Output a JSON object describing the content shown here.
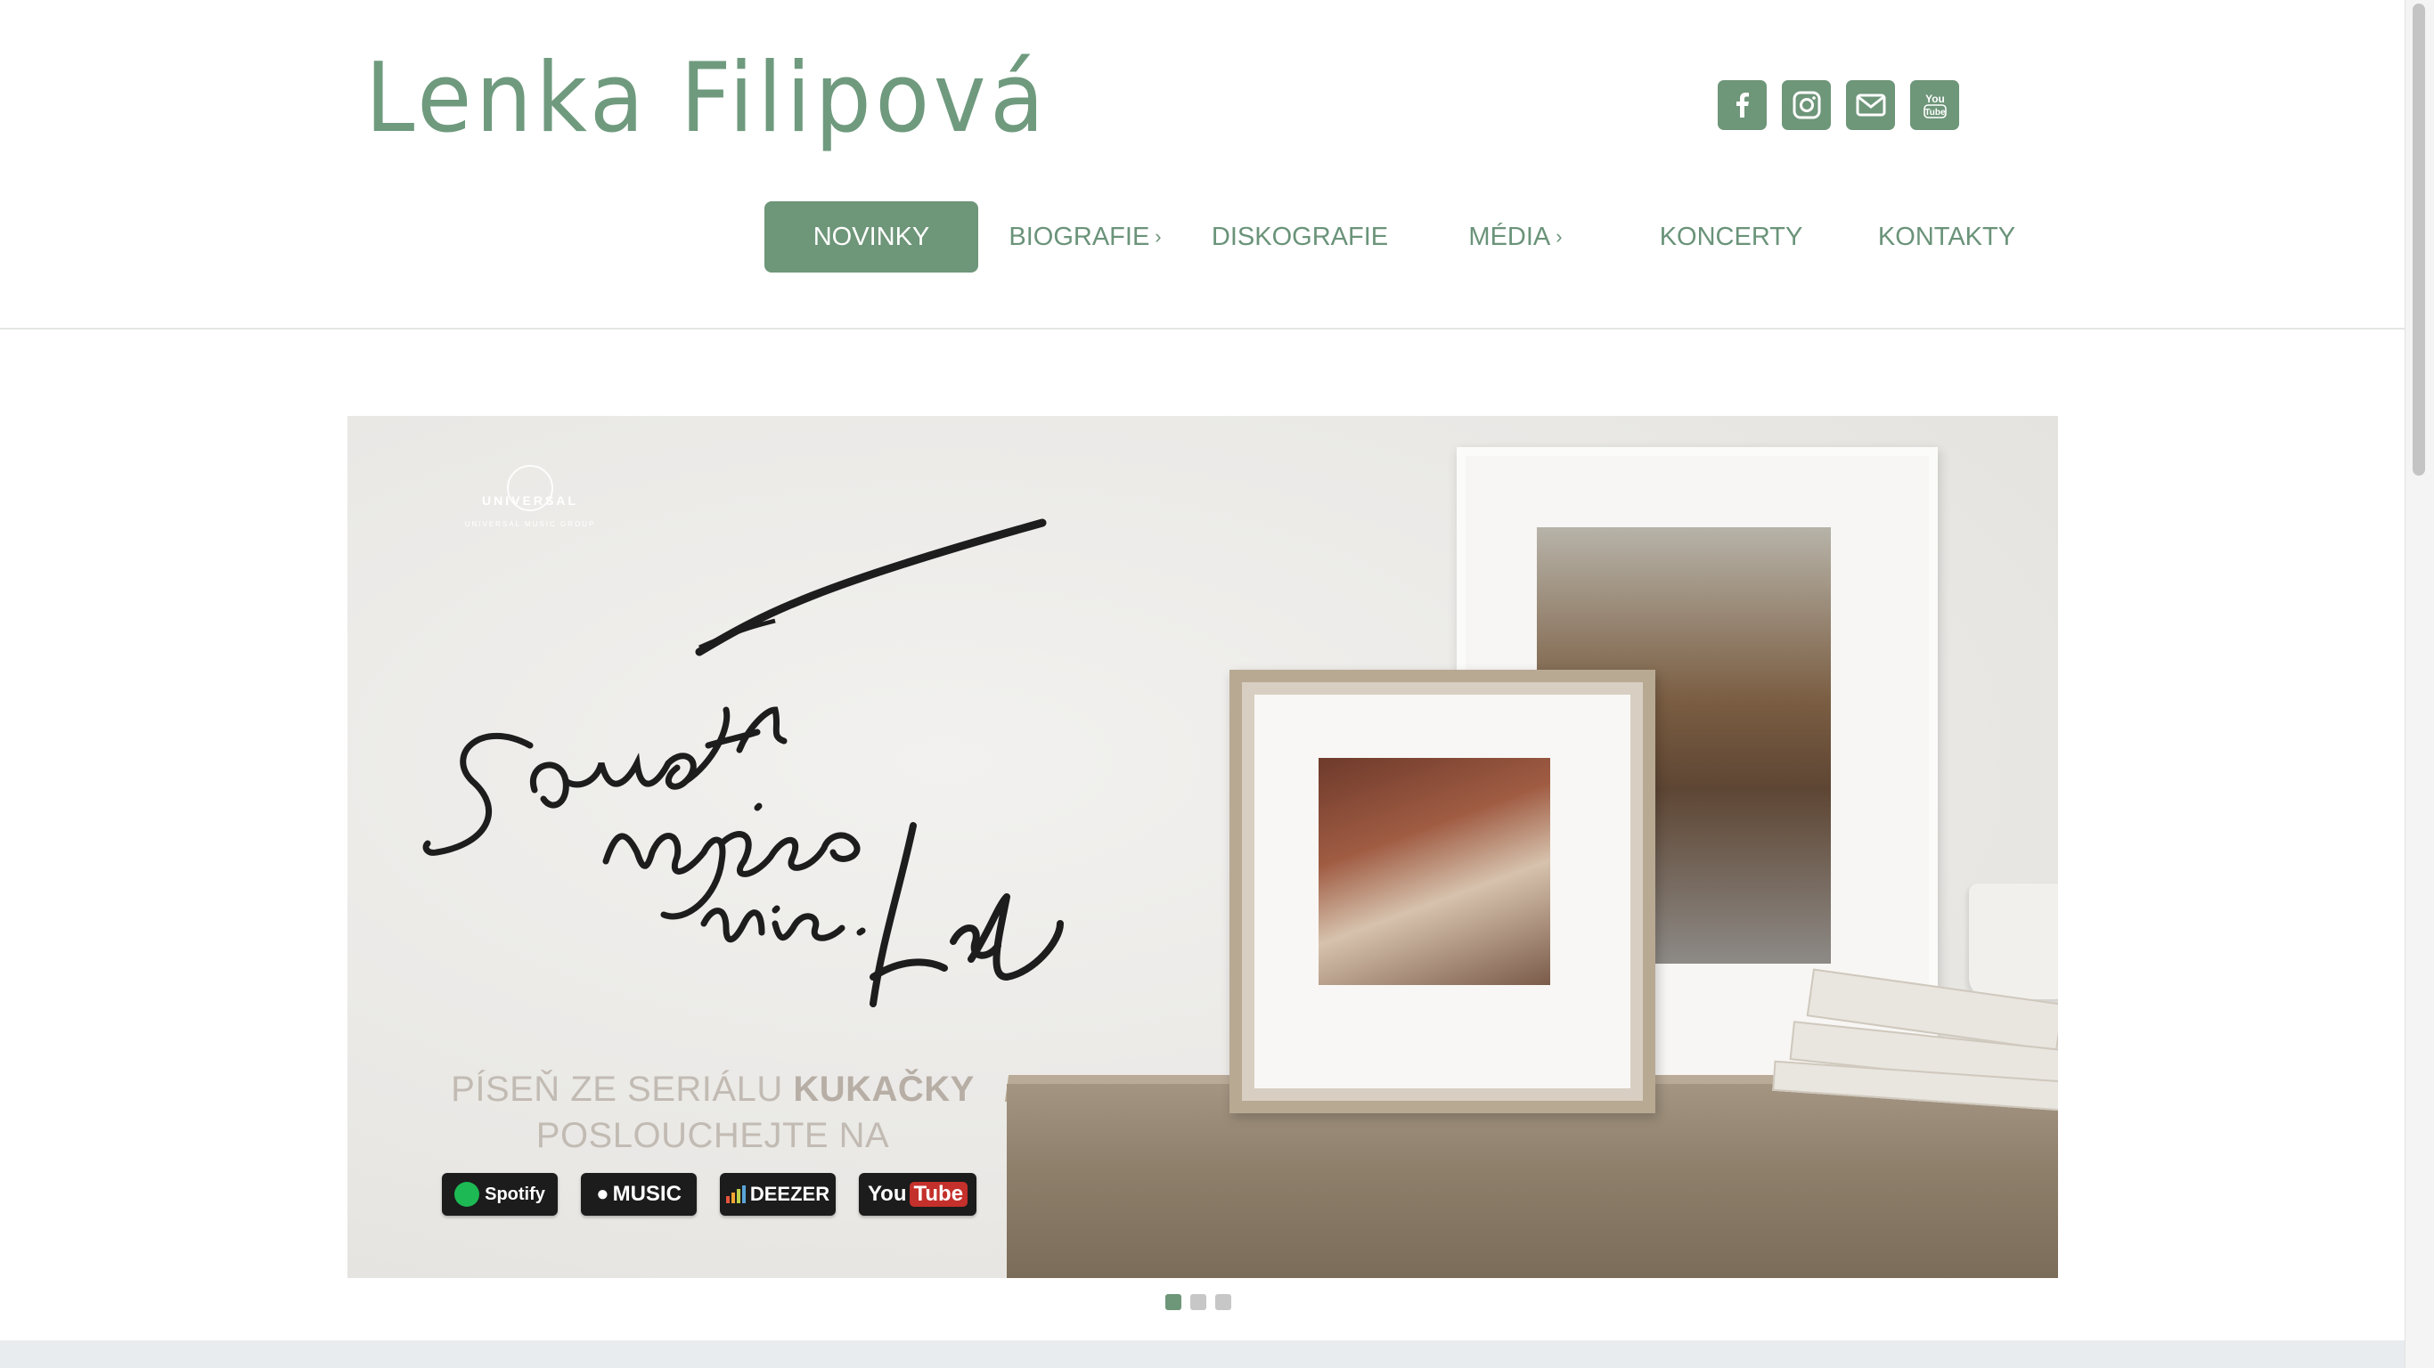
{
  "header": {
    "logo": "Lenka Filipová",
    "social": [
      {
        "icon": "facebook-icon"
      },
      {
        "icon": "instagram-icon"
      },
      {
        "icon": "mail-icon"
      },
      {
        "icon": "youtube-icon"
      }
    ]
  },
  "nav": {
    "items": [
      {
        "label": "NOVINKY",
        "active": true,
        "submenu": false
      },
      {
        "label": "BIOGRAFIE",
        "active": false,
        "submenu": true
      },
      {
        "label": "DISKOGRAFIE",
        "active": false,
        "submenu": false
      },
      {
        "label": "MÉDIA",
        "active": false,
        "submenu": true
      },
      {
        "label": "KONCERTY",
        "active": false,
        "submenu": false
      },
      {
        "label": "KONTAKTY",
        "active": false,
        "submenu": false
      }
    ],
    "chevron": "›"
  },
  "banner": {
    "label_universal": "UNIVERSAL",
    "label_umg": "UNIVERSAL MUSIC GROUP",
    "handwriting": "Samotní nejsme nic. L&L",
    "tagline_line1_prefix": "PÍSEŇ ZE SERIÁLU",
    "tagline_line1_bold": "KUKAČKY",
    "tagline_line2": "POSLOUCHEJTE NA",
    "streaming": {
      "spotify": "Spotify",
      "apple": "MUSIC",
      "deezer": "DEEZER",
      "youtube_you": "You",
      "youtube_tube": "Tube"
    }
  },
  "slider": {
    "count": 3,
    "active_index": 0
  },
  "colors": {
    "accent": "#6e9679",
    "text_green": "#6a9379",
    "logo": "#6f9a7e"
  }
}
